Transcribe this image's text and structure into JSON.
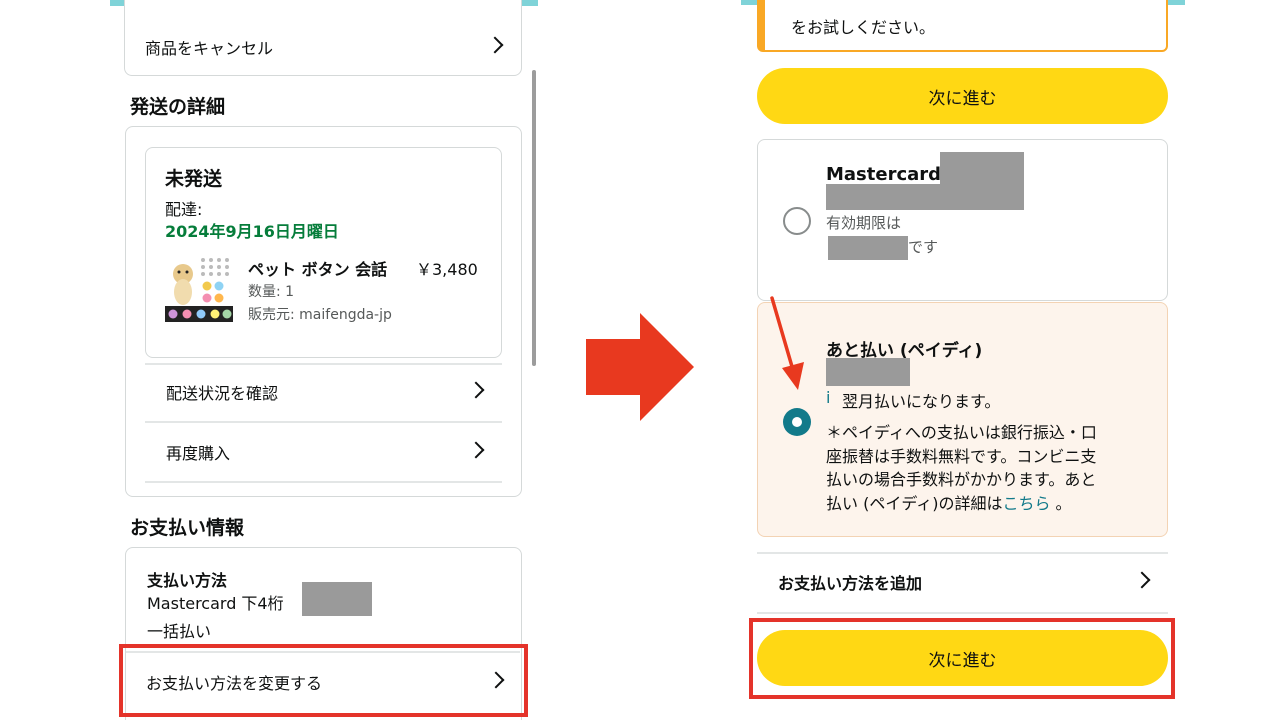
{
  "left": {
    "cancel_label": "商品をキャンセル",
    "shipping_heading": "発送の詳細",
    "status": "未発送",
    "delivery_label": "配達:",
    "delivery_date": "2024年9月16日月曜日",
    "product": {
      "name": "ペット ボタン 会話",
      "price": "￥3,480",
      "quantity": "数量: 1",
      "seller": "販売元: maifengda-jp"
    },
    "track_label": "配送状況を確認",
    "rebuy_label": "再度購入",
    "payment_heading": "お支払い情報",
    "method_label": "支払い方法",
    "card_text": "Mastercard 下4桁",
    "installment": "一括払い",
    "change_method_label": "お支払い方法を変更する"
  },
  "right": {
    "notice_text": "をお試しください。",
    "next_label_top": "次に進む",
    "card_option": {
      "name": "Mastercard",
      "expiry_label": "有効期限は",
      "expiry_suffix": "です"
    },
    "paidy_option": {
      "title": "あと払い (ペイディ)",
      "info_icon": "i",
      "info_text": "翌月払いになります。",
      "note_lines": [
        "＊ペイディへの支払いは銀行振込・口",
        "座振替は手数料無料です。コンビニ支",
        "払いの場合手数料がかかります。あと"
      ],
      "note_last_prefix": "払い (ペイディ)の詳細は",
      "note_link": "こちら",
      "note_last_suffix": " 。"
    },
    "add_method_label": "お支払い方法を追加",
    "next_label_bottom": "次に進む"
  },
  "colors": {
    "delivery_green": "#067d3b",
    "button_yellow": "#ffd814",
    "highlight_red": "#e4332a",
    "arrow_red": "#e8391f",
    "radio_teal": "#127a8a",
    "paidy_bg": "#fdf4ec",
    "notice_orange": "#f9a825",
    "link_teal": "#127a8a"
  },
  "icons": {
    "chevron": "chevron-right-icon",
    "info": "info-icon",
    "arrow": "arrow-right-icon",
    "pointer": "red-pointer-arrow-icon"
  }
}
